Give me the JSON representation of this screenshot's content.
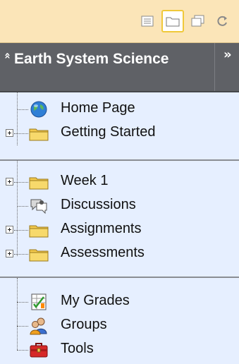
{
  "toolbar": {
    "buttons": [
      {
        "icon": "list-view-icon"
      },
      {
        "icon": "folder-view-icon",
        "active": true
      },
      {
        "icon": "new-window-icon"
      },
      {
        "icon": "refresh-icon"
      }
    ]
  },
  "course": {
    "title": "Earth System Science",
    "collapse_glyph": "«",
    "expand_glyph": "»"
  },
  "sections": [
    {
      "items": [
        {
          "label": "Home Page",
          "icon": "globe-icon",
          "expandable": false
        },
        {
          "label": "Getting Started",
          "icon": "folder-icon",
          "expandable": true
        }
      ]
    },
    {
      "items": [
        {
          "label": "Week 1",
          "icon": "folder-icon",
          "expandable": true
        },
        {
          "label": "Discussions",
          "icon": "discussions-icon",
          "expandable": false
        },
        {
          "label": "Assignments",
          "icon": "folder-icon",
          "expandable": true
        },
        {
          "label": "Assessments",
          "icon": "folder-icon",
          "expandable": true
        }
      ]
    },
    {
      "items": [
        {
          "label": "My Grades",
          "icon": "grades-icon",
          "expandable": false
        },
        {
          "label": "Groups",
          "icon": "groups-icon",
          "expandable": false
        },
        {
          "label": "Tools",
          "icon": "tools-icon",
          "expandable": false
        }
      ]
    }
  ],
  "colors": {
    "toolbar_bg": "#fbe5b8",
    "header_bg": "#5f6166",
    "tree_bg": "#e6efff",
    "folder": "#f2c84b"
  }
}
